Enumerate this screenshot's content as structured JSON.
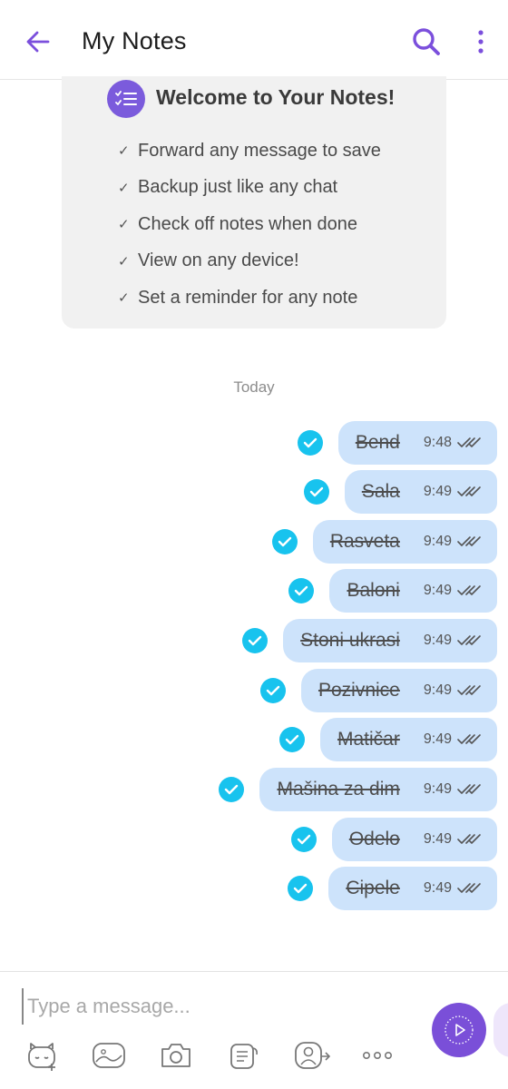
{
  "header": {
    "title": "My Notes",
    "back_icon": "arrow-left-icon",
    "search_icon": "search-icon",
    "menu_icon": "more-vertical-icon",
    "accent_color": "#7b4fdc"
  },
  "welcome": {
    "title": "Welcome to Your Notes!",
    "check_glyph": "✓",
    "features": [
      "Forward any message to save",
      "Backup just like any chat",
      "Check off notes when done",
      "View on any device!",
      "Set a reminder for any note"
    ]
  },
  "date_separator": "Today",
  "notes": [
    {
      "text": "Bend",
      "time": "9:48",
      "checked": true
    },
    {
      "text": "Sala",
      "time": "9:49",
      "checked": true
    },
    {
      "text": "Rasveta",
      "time": "9:49",
      "checked": true
    },
    {
      "text": "Baloni",
      "time": "9:49",
      "checked": true
    },
    {
      "text": "Stoni ukrasi",
      "time": "9:49",
      "checked": true
    },
    {
      "text": "Pozivnice",
      "time": "9:49",
      "checked": true
    },
    {
      "text": "Matičar",
      "time": "9:49",
      "checked": true
    },
    {
      "text": "Mašina za dim",
      "time": "9:49",
      "checked": true
    },
    {
      "text": "Odelo",
      "time": "9:49",
      "checked": true
    },
    {
      "text": "Cipele",
      "time": "9:49",
      "checked": true
    }
  ],
  "composer": {
    "placeholder": "Type a message...",
    "value": "",
    "tools": [
      "sticker-icon",
      "gallery-icon",
      "camera-icon",
      "note-icon",
      "share-contact-icon",
      "more-horizontal-icon"
    ],
    "send_icon": "send-icon"
  },
  "colors": {
    "bubble": "#cde3fb",
    "check": "#18c3ee",
    "send_button": "#7a4fd8"
  }
}
